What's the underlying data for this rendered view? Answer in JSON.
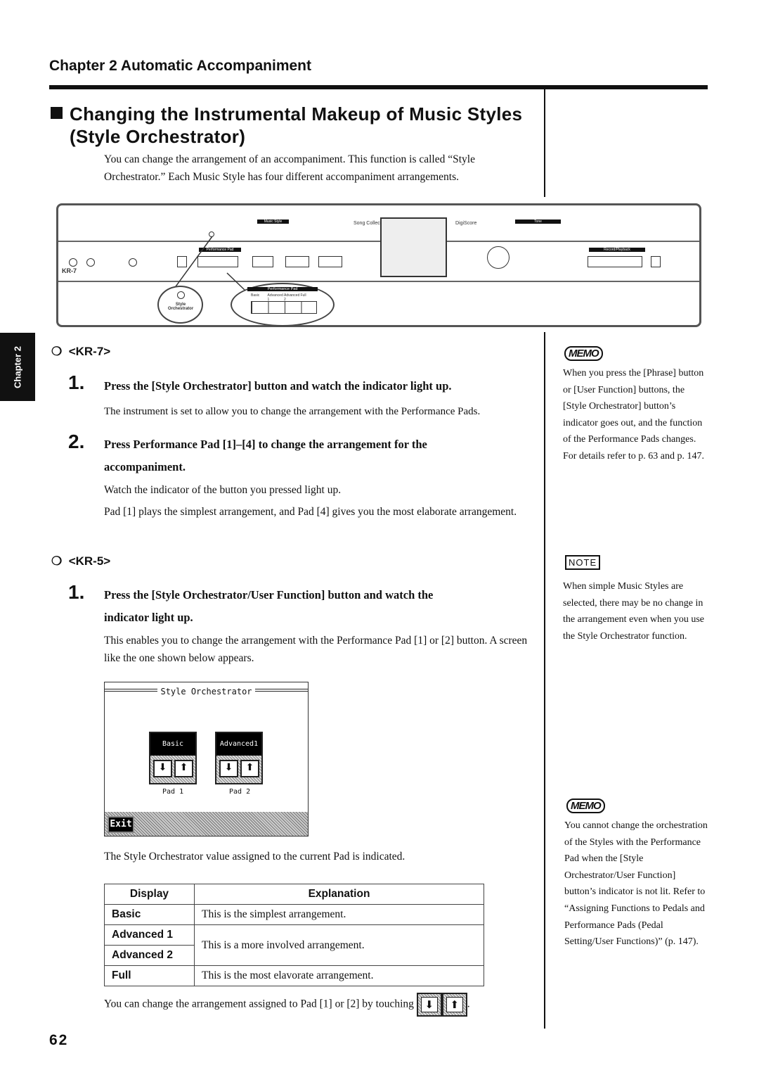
{
  "header": {
    "chapter": "Chapter 2 Automatic Accompaniment"
  },
  "side_tab": "Chapter 2",
  "section": {
    "title_line1": "Changing the Instrumental Makeup of Music Styles",
    "title_line2": "(Style Orchestrator)",
    "intro": "You can change the arrangement of an accompaniment. This function is called “Style Orchestrator.” Each Music Style has four different accompaniment arrangements."
  },
  "panel": {
    "model": "KR-7",
    "perf_pad_label": "Performance Pad",
    "pads": [
      "Basic",
      "Advanced 1",
      "Advanced 2",
      "Full"
    ],
    "style_orch": "Style Orchestrator",
    "song_collection": "Song Collection",
    "digiscore": "DigiScore"
  },
  "kr7": {
    "heading": "<KR-7>",
    "step1_num": "1.",
    "step1": "Press the [Style Orchestrator] button and watch the indicator light up.",
    "step1_text": "The instrument is set to allow you to change the arrangement with the Performance Pads.",
    "step2_num": "2.",
    "step2a": "Press Performance Pad [1]–[4] to change the arrangement for the",
    "step2b": "accompaniment.",
    "step2_text1": "Watch the indicator of the button you pressed light up.",
    "step2_text2": "Pad [1] plays the simplest arrangement, and Pad [4] gives you the most elaborate arrangement."
  },
  "kr5": {
    "heading": "<KR-5>",
    "step1_num": "1.",
    "step1a": "Press the [Style Orchestrator/User Function] button and watch the",
    "step1b": "indicator light up.",
    "step1_text": "This enables you to change the arrangement with the Performance Pad [1] or [2] button. A screen like the one shown below appears."
  },
  "screen": {
    "title": "Style Orchestrator",
    "pad1_value": "Basic",
    "pad2_value": "Advanced1",
    "pad1_label": "Pad 1",
    "pad2_label": "Pad 2",
    "exit": "Exit"
  },
  "after_screen": "The Style Orchestrator value assigned to the current Pad is indicated.",
  "table": {
    "headers": [
      "Display",
      "Explanation"
    ],
    "rows": [
      {
        "display": "Basic",
        "explanation": "This is the simplest arrangement."
      },
      {
        "display": "Advanced 1",
        "explanation": "This is a more involved arrangement."
      },
      {
        "display": "Advanced 2",
        "explanation": ""
      },
      {
        "display": "Full",
        "explanation": "This is the most elavorate arrangement."
      }
    ]
  },
  "footer_text": "You can change the arrangement assigned to Pad [1] or [2] by touching",
  "footer_period": ".",
  "sidebar": {
    "memo1_label": "MEMO",
    "memo1": "When you press the [Phrase] button or [User Function] buttons, the [Style Orchestrator] button’s indicator goes out, and the function of the Performance Pads changes. For details refer to p. 63 and p. 147.",
    "note_label": "NOTE",
    "note": "When simple Music Styles are selected, there may be no change in the arrangement even when you use the Style Orchestrator function.",
    "memo2_label": "MEMO",
    "memo2": "You cannot change the orchestration of the Styles with the Performance Pad when the [Style Orchestrator/User Function] button’s indicator is not lit. Refer to “Assigning Functions to Pedals and Performance Pads (Pedal Setting/User Functions)” (p. 147)."
  },
  "page_number": "62"
}
